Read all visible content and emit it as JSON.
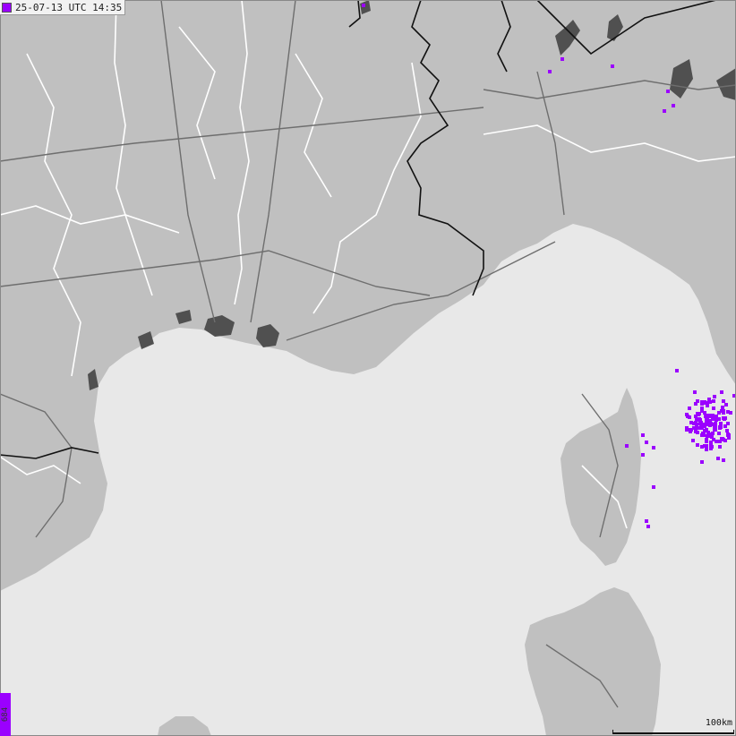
{
  "map": {
    "timestamp": "25-07-13 UTC 14:35",
    "strike_count": "684",
    "scale_label": "100km",
    "colors": {
      "sea": "#e8e8e8",
      "land": "#c0c0c0",
      "urban": "#505050",
      "borders": "#111111",
      "roads": "#6e6e6e",
      "rivers": "#ffffff",
      "lightning": "#9b00ff"
    },
    "legend_icon": "color-swatch-icon"
  }
}
